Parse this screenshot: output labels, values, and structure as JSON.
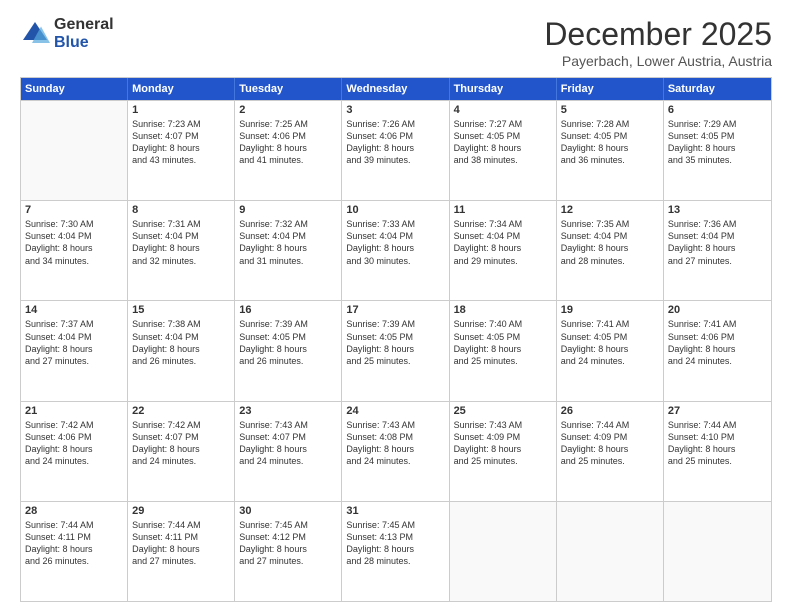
{
  "logo": {
    "general": "General",
    "blue": "Blue"
  },
  "title": "December 2025",
  "location": "Payerbach, Lower Austria, Austria",
  "header_days": [
    "Sunday",
    "Monday",
    "Tuesday",
    "Wednesday",
    "Thursday",
    "Friday",
    "Saturday"
  ],
  "weeks": [
    [
      {
        "day": "",
        "sunrise": "",
        "sunset": "",
        "daylight": ""
      },
      {
        "day": "1",
        "sunrise": "Sunrise: 7:23 AM",
        "sunset": "Sunset: 4:07 PM",
        "daylight": "Daylight: 8 hours and 43 minutes."
      },
      {
        "day": "2",
        "sunrise": "Sunrise: 7:25 AM",
        "sunset": "Sunset: 4:06 PM",
        "daylight": "Daylight: 8 hours and 41 minutes."
      },
      {
        "day": "3",
        "sunrise": "Sunrise: 7:26 AM",
        "sunset": "Sunset: 4:06 PM",
        "daylight": "Daylight: 8 hours and 39 minutes."
      },
      {
        "day": "4",
        "sunrise": "Sunrise: 7:27 AM",
        "sunset": "Sunset: 4:05 PM",
        "daylight": "Daylight: 8 hours and 38 minutes."
      },
      {
        "day": "5",
        "sunrise": "Sunrise: 7:28 AM",
        "sunset": "Sunset: 4:05 PM",
        "daylight": "Daylight: 8 hours and 36 minutes."
      },
      {
        "day": "6",
        "sunrise": "Sunrise: 7:29 AM",
        "sunset": "Sunset: 4:05 PM",
        "daylight": "Daylight: 8 hours and 35 minutes."
      }
    ],
    [
      {
        "day": "7",
        "sunrise": "Sunrise: 7:30 AM",
        "sunset": "Sunset: 4:04 PM",
        "daylight": "Daylight: 8 hours and 34 minutes."
      },
      {
        "day": "8",
        "sunrise": "Sunrise: 7:31 AM",
        "sunset": "Sunset: 4:04 PM",
        "daylight": "Daylight: 8 hours and 32 minutes."
      },
      {
        "day": "9",
        "sunrise": "Sunrise: 7:32 AM",
        "sunset": "Sunset: 4:04 PM",
        "daylight": "Daylight: 8 hours and 31 minutes."
      },
      {
        "day": "10",
        "sunrise": "Sunrise: 7:33 AM",
        "sunset": "Sunset: 4:04 PM",
        "daylight": "Daylight: 8 hours and 30 minutes."
      },
      {
        "day": "11",
        "sunrise": "Sunrise: 7:34 AM",
        "sunset": "Sunset: 4:04 PM",
        "daylight": "Daylight: 8 hours and 29 minutes."
      },
      {
        "day": "12",
        "sunrise": "Sunrise: 7:35 AM",
        "sunset": "Sunset: 4:04 PM",
        "daylight": "Daylight: 8 hours and 28 minutes."
      },
      {
        "day": "13",
        "sunrise": "Sunrise: 7:36 AM",
        "sunset": "Sunset: 4:04 PM",
        "daylight": "Daylight: 8 hours and 27 minutes."
      }
    ],
    [
      {
        "day": "14",
        "sunrise": "Sunrise: 7:37 AM",
        "sunset": "Sunset: 4:04 PM",
        "daylight": "Daylight: 8 hours and 27 minutes."
      },
      {
        "day": "15",
        "sunrise": "Sunrise: 7:38 AM",
        "sunset": "Sunset: 4:04 PM",
        "daylight": "Daylight: 8 hours and 26 minutes."
      },
      {
        "day": "16",
        "sunrise": "Sunrise: 7:39 AM",
        "sunset": "Sunset: 4:05 PM",
        "daylight": "Daylight: 8 hours and 26 minutes."
      },
      {
        "day": "17",
        "sunrise": "Sunrise: 7:39 AM",
        "sunset": "Sunset: 4:05 PM",
        "daylight": "Daylight: 8 hours and 25 minutes."
      },
      {
        "day": "18",
        "sunrise": "Sunrise: 7:40 AM",
        "sunset": "Sunset: 4:05 PM",
        "daylight": "Daylight: 8 hours and 25 minutes."
      },
      {
        "day": "19",
        "sunrise": "Sunrise: 7:41 AM",
        "sunset": "Sunset: 4:05 PM",
        "daylight": "Daylight: 8 hours and 24 minutes."
      },
      {
        "day": "20",
        "sunrise": "Sunrise: 7:41 AM",
        "sunset": "Sunset: 4:06 PM",
        "daylight": "Daylight: 8 hours and 24 minutes."
      }
    ],
    [
      {
        "day": "21",
        "sunrise": "Sunrise: 7:42 AM",
        "sunset": "Sunset: 4:06 PM",
        "daylight": "Daylight: 8 hours and 24 minutes."
      },
      {
        "day": "22",
        "sunrise": "Sunrise: 7:42 AM",
        "sunset": "Sunset: 4:07 PM",
        "daylight": "Daylight: 8 hours and 24 minutes."
      },
      {
        "day": "23",
        "sunrise": "Sunrise: 7:43 AM",
        "sunset": "Sunset: 4:07 PM",
        "daylight": "Daylight: 8 hours and 24 minutes."
      },
      {
        "day": "24",
        "sunrise": "Sunrise: 7:43 AM",
        "sunset": "Sunset: 4:08 PM",
        "daylight": "Daylight: 8 hours and 24 minutes."
      },
      {
        "day": "25",
        "sunrise": "Sunrise: 7:43 AM",
        "sunset": "Sunset: 4:09 PM",
        "daylight": "Daylight: 8 hours and 25 minutes."
      },
      {
        "day": "26",
        "sunrise": "Sunrise: 7:44 AM",
        "sunset": "Sunset: 4:09 PM",
        "daylight": "Daylight: 8 hours and 25 minutes."
      },
      {
        "day": "27",
        "sunrise": "Sunrise: 7:44 AM",
        "sunset": "Sunset: 4:10 PM",
        "daylight": "Daylight: 8 hours and 25 minutes."
      }
    ],
    [
      {
        "day": "28",
        "sunrise": "Sunrise: 7:44 AM",
        "sunset": "Sunset: 4:11 PM",
        "daylight": "Daylight: 8 hours and 26 minutes."
      },
      {
        "day": "29",
        "sunrise": "Sunrise: 7:44 AM",
        "sunset": "Sunset: 4:11 PM",
        "daylight": "Daylight: 8 hours and 27 minutes."
      },
      {
        "day": "30",
        "sunrise": "Sunrise: 7:45 AM",
        "sunset": "Sunset: 4:12 PM",
        "daylight": "Daylight: 8 hours and 27 minutes."
      },
      {
        "day": "31",
        "sunrise": "Sunrise: 7:45 AM",
        "sunset": "Sunset: 4:13 PM",
        "daylight": "Daylight: 8 hours and 28 minutes."
      },
      {
        "day": "",
        "sunrise": "",
        "sunset": "",
        "daylight": ""
      },
      {
        "day": "",
        "sunrise": "",
        "sunset": "",
        "daylight": ""
      },
      {
        "day": "",
        "sunrise": "",
        "sunset": "",
        "daylight": ""
      }
    ]
  ]
}
